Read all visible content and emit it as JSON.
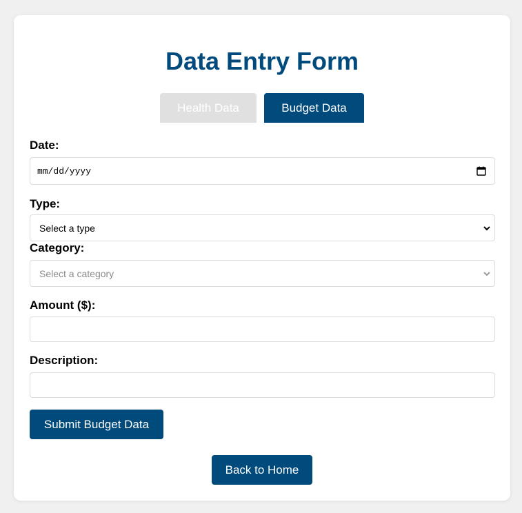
{
  "form": {
    "title": "Data Entry Form",
    "tabs": [
      {
        "label": "Health Data",
        "active": false
      },
      {
        "label": "Budget Data",
        "active": true
      }
    ],
    "date": {
      "label": "Date:",
      "placeholder": "mm/dd/yyyy",
      "icon": "calendar-icon"
    },
    "type": {
      "label": "Type:",
      "selected": "Select a type",
      "icon": "chevron-down-icon"
    },
    "category": {
      "label": "Category:",
      "selected": "Select a category",
      "disabled": true,
      "icon": "chevron-down-icon"
    },
    "amount": {
      "label": "Amount ($):",
      "value": ""
    },
    "description": {
      "label": "Description:",
      "value": ""
    },
    "submit_label": "Submit Budget Data",
    "back_label": "Back to Home"
  },
  "colors": {
    "primary": "#004a7c",
    "inactive_tab": "#e0e0e0",
    "background": "#f0f0f0"
  }
}
